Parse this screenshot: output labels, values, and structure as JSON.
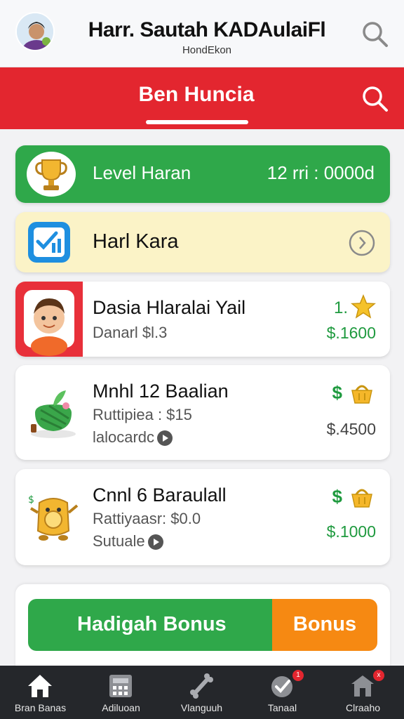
{
  "header": {
    "title": "Harr. Sautah KADAulaiFl",
    "subtitle": "HondEkon"
  },
  "red_bar": {
    "title": "Ben Huncia"
  },
  "level_card": {
    "label": "Level Haran",
    "value": "12 rri : 0000d"
  },
  "hard_card": {
    "label": "Harl Kara"
  },
  "items": [
    {
      "title": "Dasia Hlaralai Yail",
      "sub": "Danarl $l.3",
      "rank": "1.",
      "value": "$.1600"
    },
    {
      "title": "Mnhl 12 Baalian",
      "sub": "Ruttipiea : $15",
      "sub2": "lalocardc",
      "dollar": "$",
      "value": "$.4500"
    },
    {
      "title": "Cnnl 6 Baraulall",
      "sub": "Rattiyaasr: $0.0",
      "sub2": "Sutuale",
      "dollar": "$",
      "value": "$.1000"
    }
  ],
  "bonus": {
    "left_label": "Hadigah Bonus",
    "right_label": "Bonus"
  },
  "nav": [
    {
      "label": "Bran Banas",
      "icon": "home-icon"
    },
    {
      "label": "Adiluoan",
      "icon": "calculator-icon"
    },
    {
      "label": "Vlanguuh",
      "icon": "bone-icon",
      "badge": ""
    },
    {
      "label": "Tanaal",
      "icon": "check-icon",
      "badge": "1"
    },
    {
      "label": "Clraaho",
      "icon": "shop-icon",
      "badge": "x"
    }
  ],
  "colors": {
    "red": "#e3262f",
    "green": "#2fa84a",
    "orange": "#f68912",
    "yellow_card": "#fbf3c7",
    "nav_bg": "#25272b"
  }
}
